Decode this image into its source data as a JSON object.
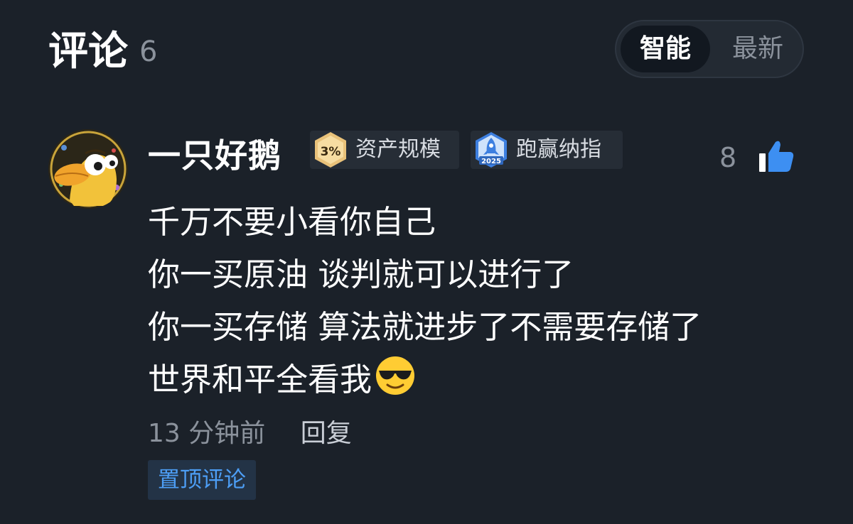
{
  "header": {
    "title": "评论",
    "count": "6"
  },
  "sort": {
    "options": [
      "智能",
      "最新"
    ],
    "selected": "智能"
  },
  "comment": {
    "username": "一只好鹅",
    "badges": [
      {
        "icon": "3%",
        "label": "资产规模"
      },
      {
        "icon": "2025",
        "label": "跑赢纳指"
      }
    ],
    "likes": "8",
    "lines": [
      "千万不要小看你自己",
      "你一买原油 谈判就可以进行了",
      "你一买存储 算法就进步了不需要存储了",
      "世界和平全看我"
    ],
    "emoji": "smiling-face-with-sunglasses",
    "time": "13 分钟前",
    "reply_label": "回复",
    "pinned_label": "置顶评论"
  },
  "colors": {
    "background": "#1b2129",
    "accent_blue": "#4d9ef5",
    "muted_text": "#8b929c"
  }
}
